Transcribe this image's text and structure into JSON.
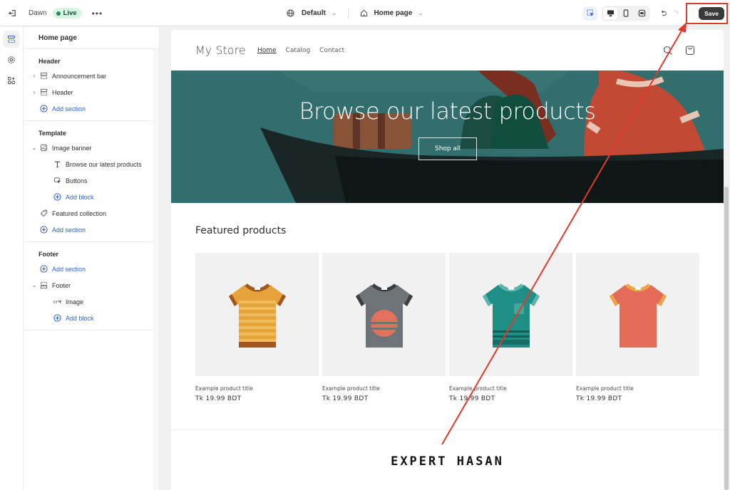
{
  "topbar": {
    "theme_name": "Dawn",
    "live_label": "Live",
    "more_label": "•••",
    "theme_selector": "Default",
    "page_selector": "Home page",
    "save_label": "Save",
    "icons": {
      "exit": "exit-icon",
      "globe": "globe-icon",
      "home": "home-icon",
      "inspect": "inspector-icon",
      "desktop": "desktop-view-icon",
      "mobile": "mobile-view-icon",
      "fullscreen": "fullscreen-icon",
      "undo": "undo-icon",
      "redo": "redo-icon"
    }
  },
  "rail": {
    "items": [
      {
        "icon": "sections-icon",
        "active": true
      },
      {
        "icon": "settings-icon",
        "active": false
      },
      {
        "icon": "apps-icon",
        "active": false
      }
    ]
  },
  "sidebar": {
    "title": "Home page",
    "groups": [
      {
        "title": "Header",
        "items": [
          {
            "label": "Announcement bar",
            "icon": "section-icon",
            "caret": "›"
          },
          {
            "label": "Header",
            "icon": "section-icon",
            "caret": "›"
          },
          {
            "label": "Add section",
            "icon": "plus-circle-icon",
            "add": true
          }
        ]
      },
      {
        "title": "Template",
        "items": [
          {
            "label": "Image banner",
            "icon": "image-icon",
            "caret": "⌄"
          },
          {
            "label": "Browse our latest products",
            "icon": "text-icon",
            "level": 2
          },
          {
            "label": "Buttons",
            "icon": "button-icon",
            "level": 2
          },
          {
            "label": "Add block",
            "icon": "plus-circle-icon",
            "level": 2,
            "add": true
          },
          {
            "label": "Featured collection",
            "icon": "tag-icon"
          },
          {
            "label": "Add section",
            "icon": "plus-circle-icon",
            "add": true
          }
        ]
      },
      {
        "title": "Footer",
        "items": [
          {
            "label": "Add section",
            "icon": "plus-circle-icon",
            "add": true
          },
          {
            "label": "Footer",
            "icon": "footer-icon",
            "caret": "⌄"
          },
          {
            "label": "Image",
            "icon": "image-block-icon",
            "level": 2
          },
          {
            "label": "Add block",
            "icon": "plus-circle-icon",
            "level": 2,
            "add": true
          }
        ]
      }
    ]
  },
  "store": {
    "logo": "My Store",
    "nav": [
      "Home",
      "Catalog",
      "Contact"
    ],
    "active_nav": "Home",
    "banner_title": "Browse our latest products",
    "banner_button": "Shop all",
    "featured_title": "Featured products",
    "products": [
      {
        "title": "Example product title",
        "price": "Tk 19.99 BDT",
        "color": "#e6a33a",
        "trim": "#a0561e",
        "style": "striped"
      },
      {
        "title": "Example product title",
        "price": "Tk 19.99 BDT",
        "color": "#6d7378",
        "trim": "#3a3f43",
        "style": "sun"
      },
      {
        "title": "Example product title",
        "price": "Tk 19.99 BDT",
        "color": "#1f8f85",
        "trim": "#5bb5ad",
        "style": "pocket"
      },
      {
        "title": "Example product title",
        "price": "Tk 19.99 BDT",
        "color": "#e36b57",
        "trim": "#eda444",
        "style": "plain"
      }
    ]
  },
  "watermark": "Expert Hasan",
  "colors": {
    "accent_link": "#2d62c8",
    "live_bg": "#d7f5e2",
    "annotation_red": "#e03a2c",
    "banner_bg": "#2f6a6a"
  }
}
